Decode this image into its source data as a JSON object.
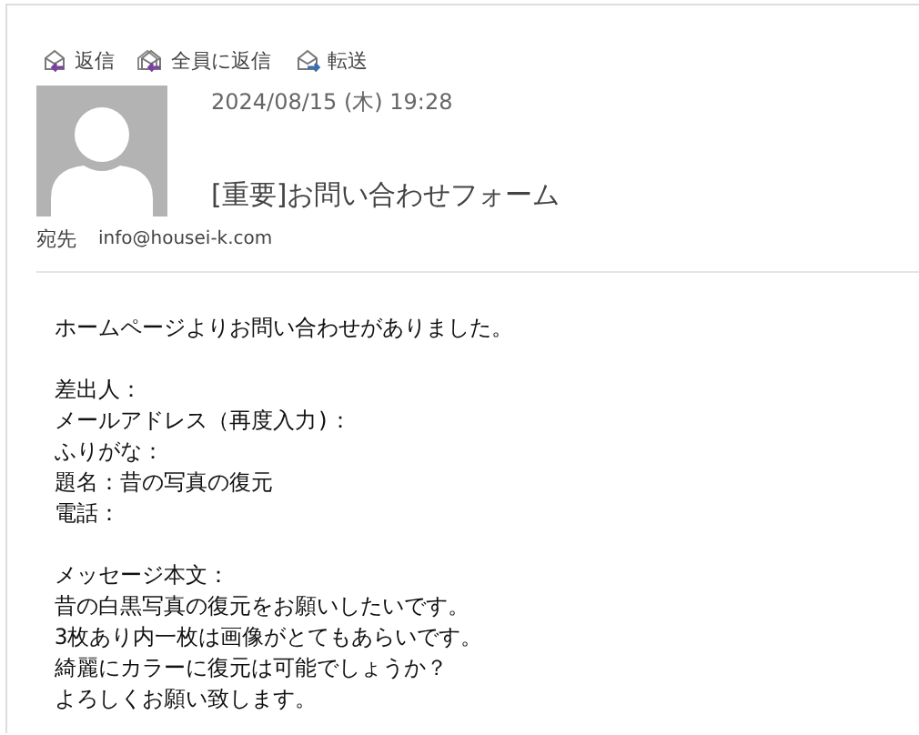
{
  "toolbar": [
    {
      "label": "返信",
      "kind": "reply"
    },
    {
      "label": "全員に返信",
      "kind": "reply-all"
    },
    {
      "label": "転送",
      "kind": "forward"
    }
  ],
  "message": {
    "date": "2024/08/15 (木) 19:28",
    "subject": "[重要]お問い合わせフォーム",
    "to_label": "宛先",
    "to": "info@housei-k.com"
  },
  "body": [
    {
      "lines": [
        "ホームページよりお問い合わせがありました。"
      ]
    },
    {
      "lines": [
        "差出人：",
        "メールアドレス（再度入力)：",
        "ふりがな：",
        "題名：昔の写真の復元",
        "電話："
      ]
    },
    {
      "lines": [
        "メッセージ本文：",
        "昔の白黒写真の復元をお願いしたいです。",
        "3枚あり内一枚は画像がとてもあらいです。",
        "綺麗にカラーに復元は可能でしょうか？",
        "よろしくお願い致します。"
      ]
    }
  ]
}
